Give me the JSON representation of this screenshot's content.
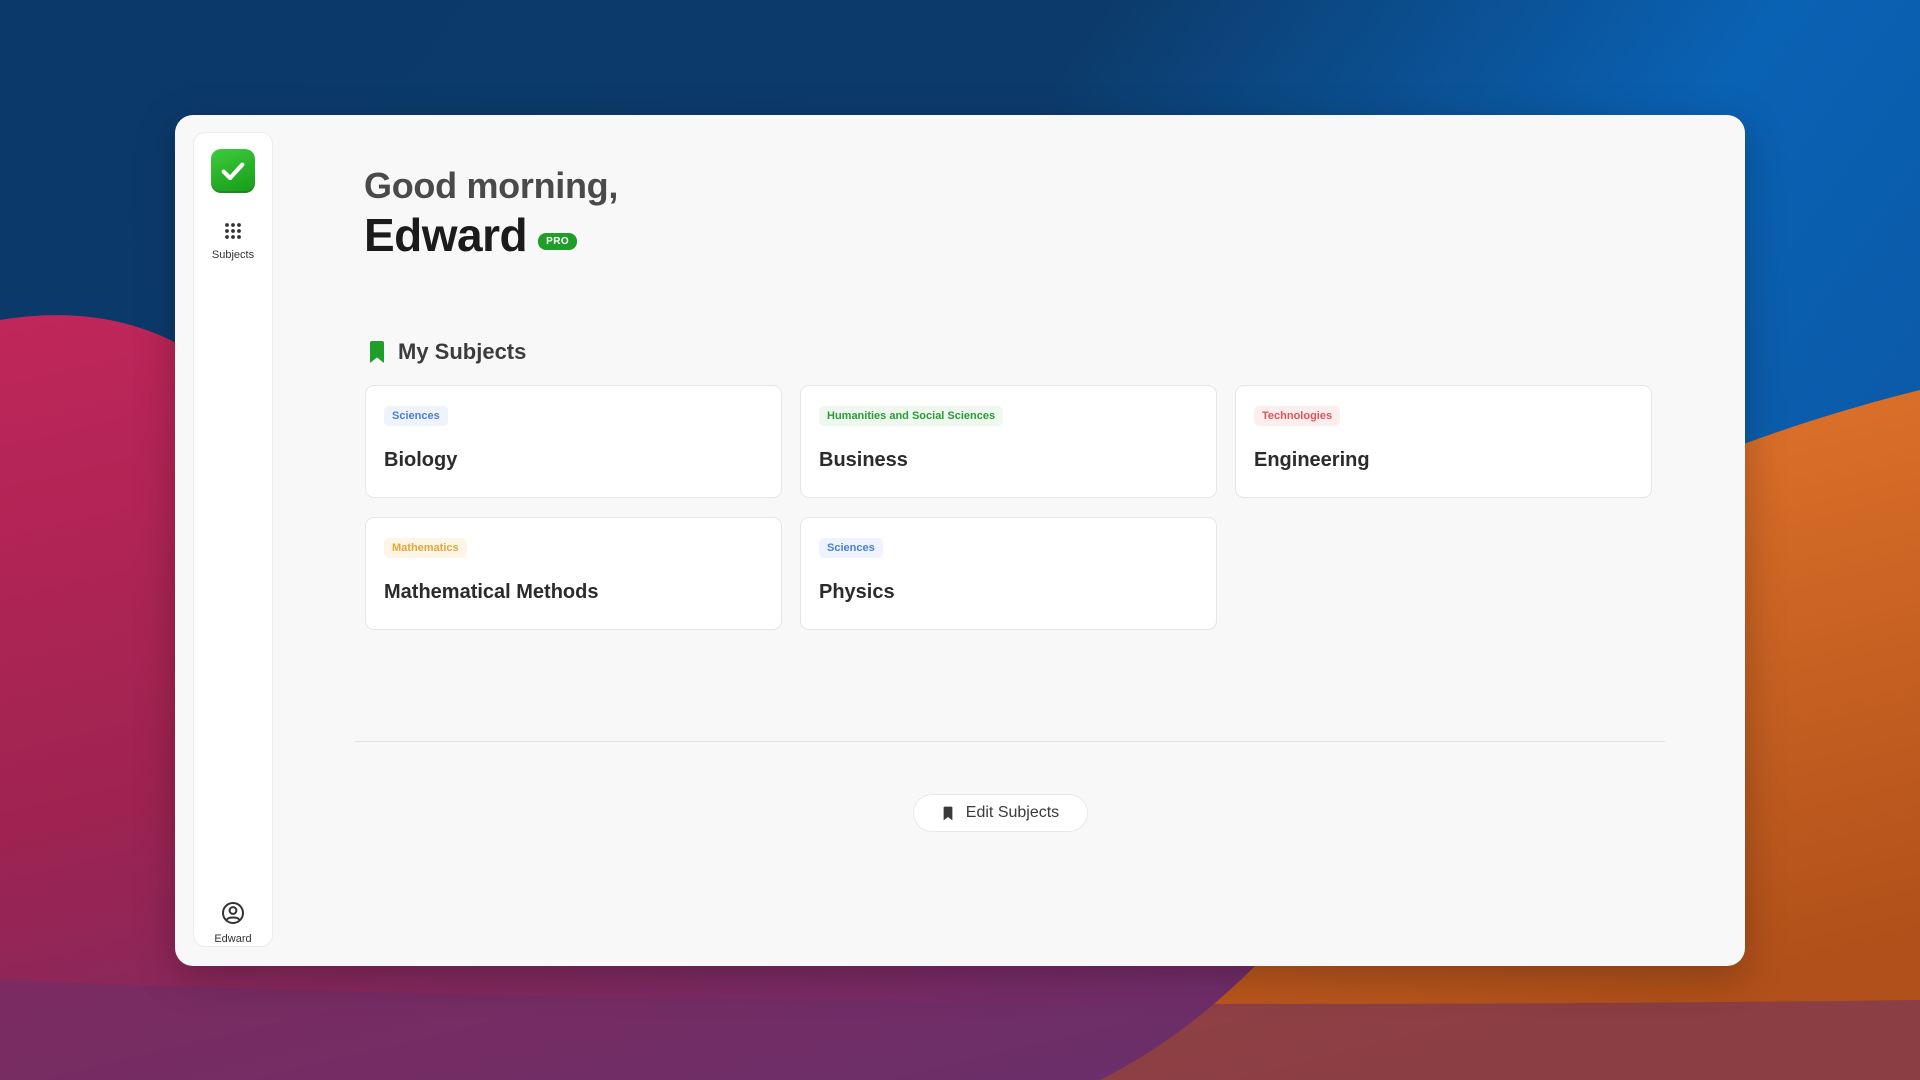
{
  "app": {
    "nav": {
      "subjects_label": "Subjects",
      "profile_label": "Edward"
    }
  },
  "greeting": {
    "line1": "Good morning,",
    "name": "Edward",
    "badge": "PRO"
  },
  "my_subjects": {
    "title": "My Subjects",
    "cards": [
      {
        "tag": "Sciences",
        "name": "Biology",
        "tag_color": "#4a7fd6",
        "tag_bg": "#eef3fd"
      },
      {
        "tag": "Humanities and Social Sciences",
        "name": "Business",
        "tag_color": "#2e9a3a",
        "tag_bg": "#eef8ef"
      },
      {
        "tag": "Technologies",
        "name": "Engineering",
        "tag_color": "#e0525c",
        "tag_bg": "#fdeeee"
      },
      {
        "tag": "Mathematics",
        "name": "Mathematical Methods",
        "tag_color": "#e2a63a",
        "tag_bg": "#fdf5e6"
      },
      {
        "tag": "Sciences",
        "name": "Physics",
        "tag_color": "#4a7fd6",
        "tag_bg": "#eef3fd"
      }
    ]
  },
  "actions": {
    "edit_subjects": "Edit Subjects"
  },
  "colors": {
    "accent": "#1f9f2a",
    "logo_green": "#2fb52f"
  }
}
